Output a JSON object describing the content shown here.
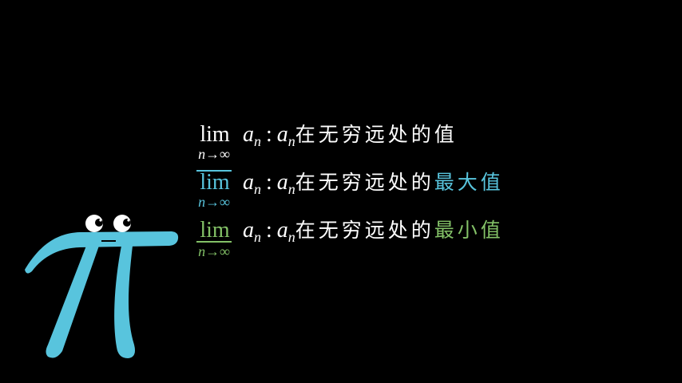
{
  "colors": {
    "upper": "#58C4DD",
    "lower": "#83C167",
    "text": "#FFFFFF",
    "pi": "#58C4DD"
  },
  "rows": [
    {
      "lim": "lim",
      "sub": "n→∞",
      "a": "a",
      "n": "n",
      "colon": ":",
      "desc": "在无穷远处的",
      "highlight": "值"
    },
    {
      "lim": "lim",
      "sub": "n→∞",
      "a": "a",
      "n": "n",
      "colon": ":",
      "desc": "在无穷远处的",
      "highlight": "最大值"
    },
    {
      "lim": "lim",
      "sub": "n→∞",
      "a": "a",
      "n": "n",
      "colon": ":",
      "desc": "在无穷远处的",
      "highlight": "最小值"
    }
  ]
}
